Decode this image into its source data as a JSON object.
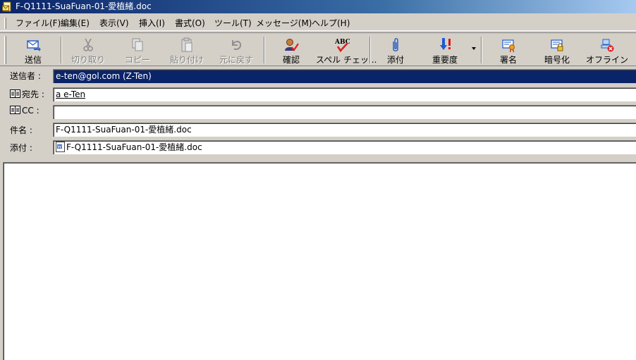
{
  "window": {
    "title": "F-Q1111-SuaFuan-01-愛植緒.doc"
  },
  "menu": [
    "ファイル(F)",
    "編集(E)",
    "表示(V)",
    "挿入(I)",
    "書式(O)",
    "ツール(T)",
    "メッセージ(M)",
    "ヘルプ(H)"
  ],
  "toolbar": {
    "send": "送信",
    "cut": "切り取り",
    "copy": "コピー",
    "paste": "貼り付け",
    "undo": "元に戻す",
    "check": "確認",
    "spell": "スペル チェッ...",
    "attach": "添付",
    "priority": "重要度",
    "sign": "署名",
    "encrypt": "暗号化",
    "offline": "オフライン",
    "spell_icon_text": "ABC"
  },
  "header": {
    "from_label": "送信者 :",
    "from_value": "e-ten@gol.com     (Z-Ten)",
    "to_label": "宛先 :",
    "to_value": "a e-Ten",
    "cc_label": "CC :",
    "cc_value": "",
    "subject_label": "件名 :",
    "subject_value": "F-Q1111-SuaFuan-01-愛植緒.doc",
    "attach_label": "添付 :",
    "attach_value": "F-Q1111-SuaFuan-01-愛植緒.doc"
  },
  "colors": {
    "title_bar": "#0a246a",
    "selection": "#0a246a",
    "send_icon": "#2a62c9",
    "priority_arrow": "#1e5ad6",
    "priority_mark": "#e01010",
    "check_mark": "#e02020"
  },
  "icons": {
    "app": "document-envelope-icon",
    "send": "send-mail-icon",
    "cut": "scissors-icon",
    "copy": "copy-icon",
    "paste": "clipboard-icon",
    "undo": "undo-icon",
    "check": "check-names-icon",
    "spell": "spellcheck-icon",
    "attach": "paperclip-icon",
    "priority": "priority-icon",
    "sign": "sign-certificate-icon",
    "encrypt": "encrypt-lock-icon",
    "offline": "offline-icon",
    "address_book": "address-book-icon",
    "word_doc": "word-doc-icon"
  }
}
